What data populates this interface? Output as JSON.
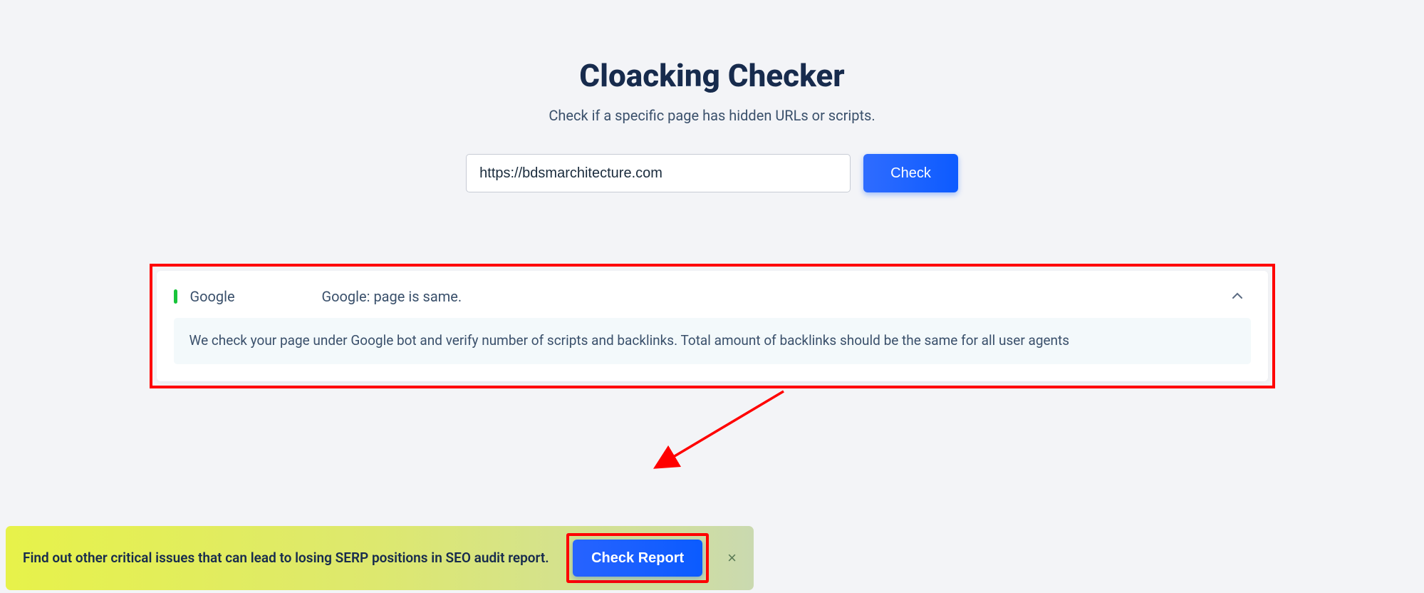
{
  "header": {
    "title": "Cloacking Checker",
    "subtitle": "Check if a specific page has hidden URLs or scripts."
  },
  "form": {
    "url_value": "https://bdsmarchitecture.com",
    "check_label": "Check"
  },
  "result": {
    "provider": "Google",
    "status_text": "Google: page is same.",
    "description": "We check your page under Google bot and verify number of scripts and backlinks. Total amount of backlinks should be the same for all user agents"
  },
  "banner": {
    "text": "Find out other critical issues that can lead to losing SERP positions in SEO audit report.",
    "cta_label": "Check Report"
  }
}
